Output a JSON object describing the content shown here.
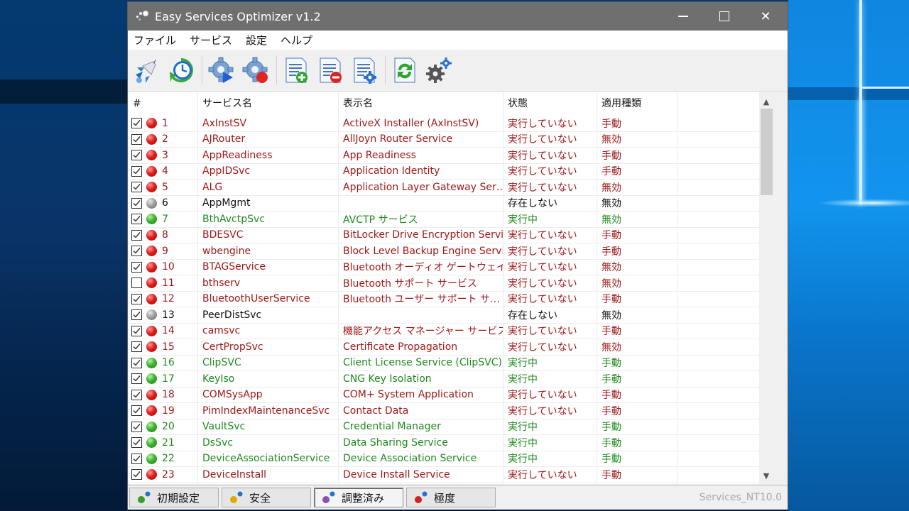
{
  "window": {
    "title": "Easy Services Optimizer v1.2",
    "controls": {
      "minimize": "minimize",
      "maximize": "maximize",
      "close": "close"
    }
  },
  "menu": [
    "ファイル",
    "サービス",
    "設定",
    "ヘルプ"
  ],
  "toolbar": [
    {
      "icon": "rocket-optimize-icon",
      "label": "Optimize"
    },
    {
      "icon": "restore-clock-icon",
      "label": "Restore default"
    },
    {
      "icon": "gear-start-icon",
      "label": "Start service"
    },
    {
      "icon": "gear-stop-icon",
      "label": "Stop service"
    },
    {
      "icon": "list-add-icon",
      "label": "Add service"
    },
    {
      "icon": "list-remove-icon",
      "label": "Remove service"
    },
    {
      "icon": "list-settings-icon",
      "label": "Service settings"
    },
    {
      "icon": "refresh-icon",
      "label": "Refresh"
    },
    {
      "icon": "gears-settings-icon",
      "label": "Settings"
    }
  ],
  "table": {
    "columns": [
      "#",
      "サービス名",
      "表示名",
      "状態",
      "適用種類"
    ],
    "rows": [
      {
        "checked": true,
        "status": "red",
        "num": "1",
        "service": "AxInstSV",
        "display": "ActiveX Installer (AxInstSV)",
        "state": "実行していない",
        "type": "手動"
      },
      {
        "checked": true,
        "status": "red",
        "num": "2",
        "service": "AJRouter",
        "display": "AllJoyn Router Service",
        "state": "実行していない",
        "type": "無効"
      },
      {
        "checked": true,
        "status": "red",
        "num": "3",
        "service": "AppReadiness",
        "display": "App Readiness",
        "state": "実行していない",
        "type": "手動"
      },
      {
        "checked": true,
        "status": "red",
        "num": "4",
        "service": "AppIDSvc",
        "display": "Application Identity",
        "state": "実行していない",
        "type": "手動"
      },
      {
        "checked": true,
        "status": "red",
        "num": "5",
        "service": "ALG",
        "display": "Application Layer Gateway Ser…",
        "state": "実行していない",
        "type": "無効"
      },
      {
        "checked": true,
        "status": "gray",
        "num": "6",
        "service": "AppMgmt",
        "display": "",
        "state": "存在しない",
        "type": "無効"
      },
      {
        "checked": true,
        "status": "green",
        "num": "7",
        "service": "BthAvctpSvc",
        "display": "AVCTP サービス",
        "state": "実行中",
        "type": "無効"
      },
      {
        "checked": true,
        "status": "red",
        "num": "8",
        "service": "BDESVC",
        "display": "BitLocker Drive Encryption Service",
        "state": "実行していない",
        "type": "手動"
      },
      {
        "checked": true,
        "status": "red",
        "num": "9",
        "service": "wbengine",
        "display": "Block Level Backup Engine Service",
        "state": "実行していない",
        "type": "手動"
      },
      {
        "checked": true,
        "status": "red",
        "num": "10",
        "service": "BTAGService",
        "display": "Bluetooth オーディオ ゲートウェイ…",
        "state": "実行していない",
        "type": "無効"
      },
      {
        "checked": false,
        "status": "red",
        "num": "11",
        "service": "bthserv",
        "display": "Bluetooth サポート サービス",
        "state": "実行していない",
        "type": "無効"
      },
      {
        "checked": true,
        "status": "red",
        "num": "12",
        "service": "BluetoothUserService",
        "display": "Bluetooth ユーザー サポート サ…",
        "state": "実行していない",
        "type": "手動"
      },
      {
        "checked": true,
        "status": "gray",
        "num": "13",
        "service": "PeerDistSvc",
        "display": "",
        "state": "存在しない",
        "type": "無効"
      },
      {
        "checked": true,
        "status": "red",
        "num": "14",
        "service": "camsvc",
        "display": "機能アクセス マネージャー サービス",
        "state": "実行していない",
        "type": "手動"
      },
      {
        "checked": true,
        "status": "red",
        "num": "15",
        "service": "CertPropSvc",
        "display": "Certificate Propagation",
        "state": "実行していない",
        "type": "無効"
      },
      {
        "checked": true,
        "status": "green",
        "num": "16",
        "service": "ClipSVC",
        "display": "Client License Service (ClipSVC)",
        "state": "実行中",
        "type": "手動"
      },
      {
        "checked": true,
        "status": "green",
        "num": "17",
        "service": "KeyIso",
        "display": "CNG Key Isolation",
        "state": "実行中",
        "type": "手動"
      },
      {
        "checked": true,
        "status": "red",
        "num": "18",
        "service": "COMSysApp",
        "display": "COM+ System Application",
        "state": "実行していない",
        "type": "手動"
      },
      {
        "checked": true,
        "status": "red",
        "num": "19",
        "service": "PimIndexMaintenanceSvc",
        "display": "Contact Data",
        "state": "実行していない",
        "type": "手動"
      },
      {
        "checked": true,
        "status": "green",
        "num": "20",
        "service": "VaultSvc",
        "display": "Credential Manager",
        "state": "実行中",
        "type": "手動"
      },
      {
        "checked": true,
        "status": "green",
        "num": "21",
        "service": "DsSvc",
        "display": "Data Sharing Service",
        "state": "実行中",
        "type": "手動"
      },
      {
        "checked": true,
        "status": "green",
        "num": "22",
        "service": "DeviceAssociationService",
        "display": "Device Association Service",
        "state": "実行中",
        "type": "手動"
      },
      {
        "checked": true,
        "status": "red",
        "num": "23",
        "service": "DeviceInstall",
        "display": "Device Install Service",
        "state": "実行していない",
        "type": "手動"
      }
    ]
  },
  "presets": [
    {
      "label": "初期設定",
      "color": "#3a9a2a",
      "active": false
    },
    {
      "label": "安全",
      "color": "#e0a800",
      "active": false
    },
    {
      "label": "調整済み",
      "color": "#8a4fb0",
      "active": true
    },
    {
      "label": "極度",
      "color": "#d02020",
      "active": false
    }
  ],
  "status_text": "Services_NT10.0",
  "colors": {
    "running": "#1e8a1e",
    "stopped": "#a01818",
    "missing": "#111111",
    "titlebar": "#6f6f6f"
  }
}
